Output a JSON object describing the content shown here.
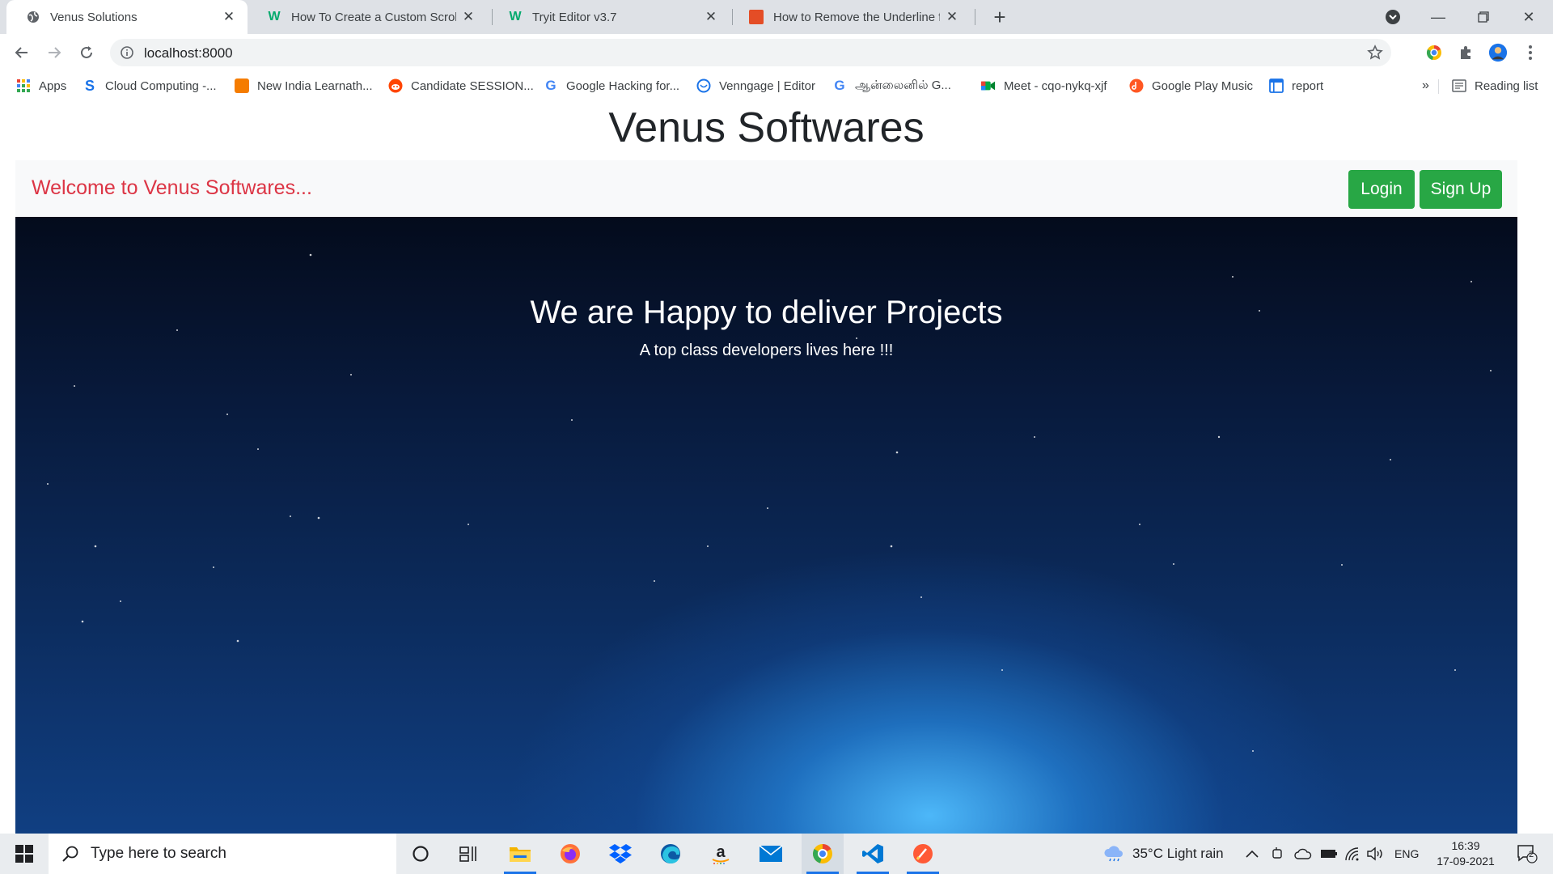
{
  "browser": {
    "tabs": [
      {
        "title": "Venus Solutions",
        "active": true,
        "favicon": "globe-icon"
      },
      {
        "title": "How To Create a Custom Scrollba",
        "active": false,
        "favicon": "w3schools-icon"
      },
      {
        "title": "Tryit Editor v3.7",
        "active": false,
        "favicon": "w3schools-icon"
      },
      {
        "title": "How to Remove the Underline fr",
        "active": false,
        "favicon": "html5-icon"
      }
    ],
    "url": "localhost:8000",
    "bookmarks": [
      {
        "label": "Apps",
        "icon": "apps-grid-icon"
      },
      {
        "label": "Cloud Computing -...",
        "icon": "s-logo-icon"
      },
      {
        "label": "New India Learnath...",
        "icon": "learnathon-icon"
      },
      {
        "label": "Candidate SESSION...",
        "icon": "reddit-like-icon"
      },
      {
        "label": "Google Hacking for...",
        "icon": "google-icon"
      },
      {
        "label": "Venngage | Editor",
        "icon": "venngage-icon"
      },
      {
        "label": "ஆன்லைனில் G...",
        "icon": "google-icon"
      },
      {
        "label": "Meet - cqo-nykq-xjf",
        "icon": "meet-icon"
      },
      {
        "label": "Google Play Music",
        "icon": "play-music-icon"
      },
      {
        "label": "report",
        "icon": "report-icon"
      }
    ],
    "more_bookmarks": "»",
    "reading_list": "Reading list"
  },
  "site": {
    "title": "Venus Softwares",
    "welcome": "Welcome to Venus Softwares...",
    "login_label": "Login",
    "signup_label": "Sign Up",
    "hero_heading": "We are Happy to deliver Projects",
    "hero_sub": "A top class developers lives here !!!"
  },
  "taskbar": {
    "search_placeholder": "Type here to search",
    "weather": "35°C  Light rain",
    "language": "ENG",
    "time": "16:39",
    "date": "17-09-2021",
    "notifications": "2"
  },
  "colors": {
    "accent_red": "#dc3545",
    "button_green": "#28a745"
  }
}
